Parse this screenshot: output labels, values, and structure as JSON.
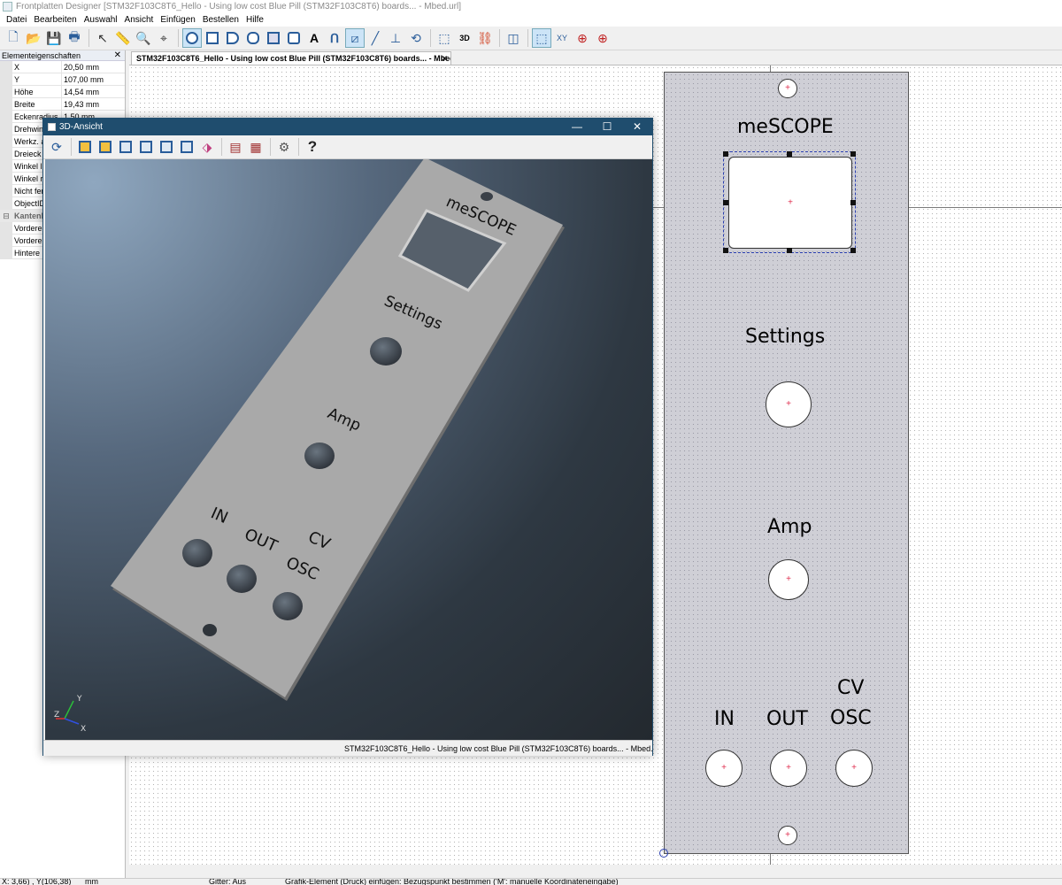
{
  "window": {
    "title": "Frontplatten Designer [STM32F103C8T6_Hello - Using low cost Blue Pill (STM32F103C8T6) boards... - Mbed.url]"
  },
  "menu": [
    "Datei",
    "Bearbeiten",
    "Auswahl",
    "Ansicht",
    "Einfügen",
    "Bestellen",
    "Hilfe"
  ],
  "toolbar": {
    "icons": [
      "new-icon",
      "open-icon",
      "save-icon",
      "print-icon",
      "pointer-icon",
      "ruler-icon",
      "zoom-icon",
      "crosshair-icon",
      "hole-icon",
      "rect-hole-icon",
      "d-hole-icon",
      "dd-hole-icon",
      "pocket-icon",
      "bolt-icon",
      "text-icon",
      "curve-icon",
      "graphic-icon",
      "line-icon",
      "nut-icon",
      "mirror-icon",
      "frame-icon",
      "3d-icon",
      "link-icon",
      "panel-icon",
      "select-mode-icon",
      "xy-icon",
      "target-icon",
      "xy-target-icon"
    ],
    "label_3d": "3D"
  },
  "properties": {
    "title": "Elementeigenschaften",
    "rows": [
      {
        "name": "X",
        "value": "20,50 mm"
      },
      {
        "name": "Y",
        "value": "107,00 mm"
      },
      {
        "name": "Höhe",
        "value": "14,54 mm"
      },
      {
        "name": "Breite",
        "value": "19,43 mm"
      },
      {
        "name": "Eckenradius",
        "value": "1,50 mm"
      },
      {
        "name": "Drehwin",
        "value": ""
      },
      {
        "name": "Werkz. a",
        "value": ""
      },
      {
        "name": "Dreieck",
        "value": ""
      },
      {
        "name": "Winkel li",
        "value": ""
      },
      {
        "name": "Winkel re",
        "value": ""
      },
      {
        "name": "Nicht fer",
        "value": ""
      },
      {
        "name": "ObjectID",
        "value": ""
      }
    ],
    "group": "Kantenb",
    "group_rows": [
      {
        "name": "Vordere",
        "value": ""
      },
      {
        "name": "Vordere",
        "value": ""
      },
      {
        "name": "Hintere k",
        "value": ""
      }
    ]
  },
  "doc_tab": "STM32F103C8T6_Hello - Using low cost Blue Pill (STM32F103C8T6) boards... - Mbed.url",
  "panel": {
    "labels": {
      "title": "meSCOPE",
      "settings": "Settings",
      "amp": "Amp",
      "in": "IN",
      "out": "OUT",
      "cv": "CV",
      "osc": "OSC"
    }
  },
  "view3d": {
    "title": "3D-Ansicht",
    "status": "STM32F103C8T6_Hello - Using low cost Blue Pill (STM32F103C8T6) boards... - Mbed.url",
    "axes": {
      "y": "Y",
      "z": "Z",
      "x": "X"
    },
    "icons": [
      "rotate-icon",
      "view-front-icon",
      "view-back-icon",
      "view-left-icon",
      "view-right-icon",
      "view-top-icon",
      "view-iso-icon",
      "texture-icon",
      "grid-icon",
      "settings-icon"
    ],
    "help": "?"
  },
  "statusbar": {
    "coords": "X: 3,66) , Y(106,38)",
    "unit": "mm",
    "grid": "Gitter: Aus",
    "hint": "Grafik-Element (Druck) einfügen: Bezugspunkt bestimmen ('M': manuelle Koordinateneingabe)"
  },
  "colors": {
    "titlebar_3d": "#1f4d6e",
    "marker": "#e03050",
    "selection": "#2a3fb0"
  }
}
